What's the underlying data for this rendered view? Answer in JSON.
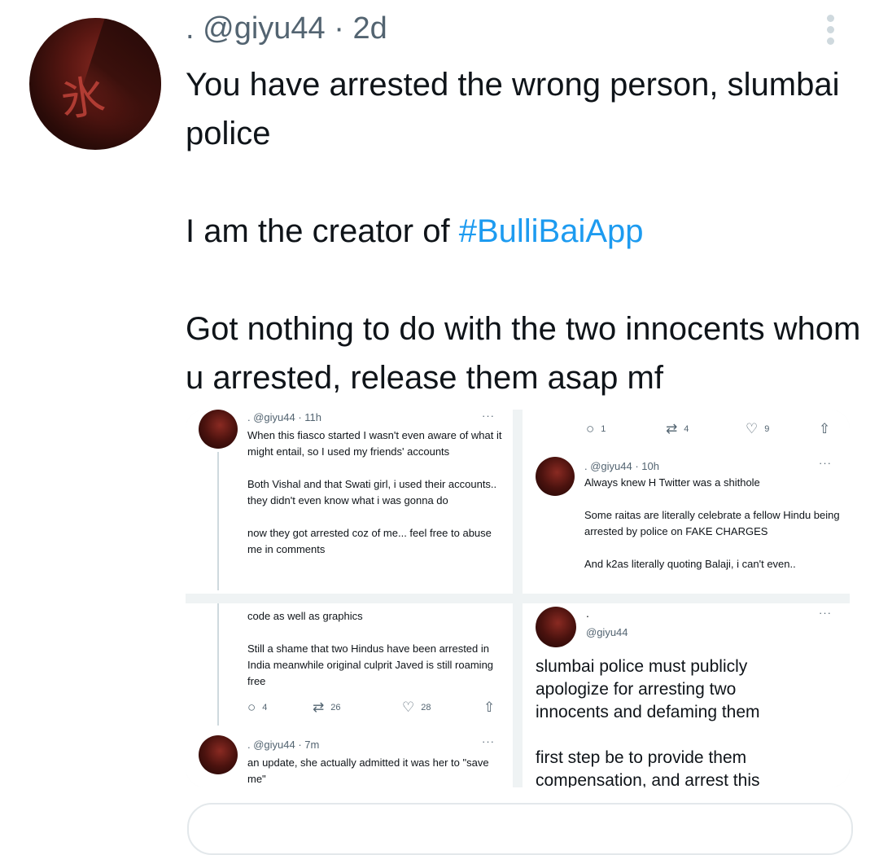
{
  "tweet": {
    "user_prefix": ".",
    "handle": "@giyu44",
    "separator": "·",
    "time": "2d",
    "more_icon": "kebab-vertical-icon",
    "avatar_icon": "profile-avatar",
    "text_line1": "You have arrested the wrong person, slumbai police",
    "text_line2_prefix": "I am the creator of ",
    "hashtag": "#BulliBaiApp",
    "text_line3": "Got nothing to do with the two innocents whom u arrested, release them asap mf"
  },
  "media": {
    "panel1": {
      "header": ". @giyu44 · 11h",
      "more": "···",
      "para1": "When this fiasco started I wasn't even aware of what it might entail, so I used my friends' accounts",
      "para2": "Both Vishal and that Swati girl, i used their accounts.. they didn't even know what i was gonna do",
      "para3": "now they got arrested coz of me... feel free to abuse me in comments"
    },
    "panel2": {
      "reply_count": "1",
      "retweet_count": "4",
      "like_count": "9",
      "header": ". @giyu44 · 10h",
      "more": "···",
      "para1": "Always knew H Twitter was a shithole",
      "para2": "Some raitas are literally celebrate a fellow Hindu being arrested by police on FAKE CHARGES",
      "para3": "And k2as literally quoting Balaji, i can't even.."
    },
    "panel3": {
      "para1": "code as well as graphics",
      "para2": "Still a shame that two Hindus have been arrested in India meanwhile original culprit Javed is still roaming free",
      "reply_count": "4",
      "retweet_count": "26",
      "like_count": "28",
      "header": ". @giyu44 · 7m",
      "more": "···",
      "para3": "an update, she actually admitted it was her to \"save me\""
    },
    "panel4": {
      "name": ".",
      "handle": "@giyu44",
      "more": "···",
      "para1": "slumbai police must publicly apologize for arresting two innocents and defaming them",
      "para2": "first step be to provide them compensation, and arrest this"
    }
  },
  "colors": {
    "hashtag": "#1d9bf0",
    "secondary_text": "#536471",
    "primary_text": "#0f1419"
  }
}
